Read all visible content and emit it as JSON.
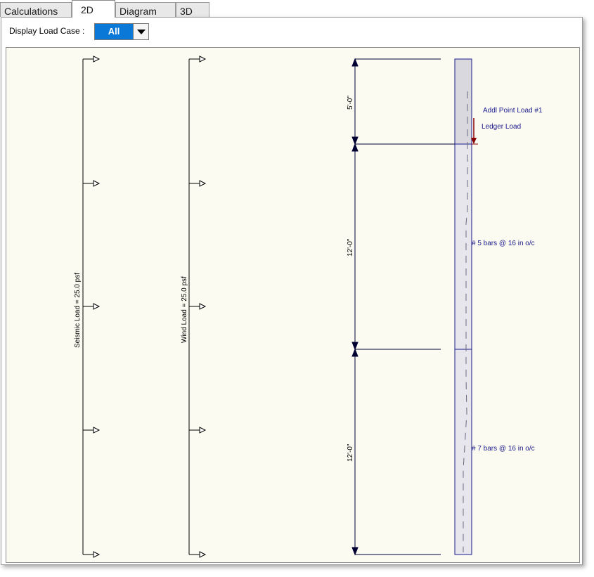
{
  "tabs": [
    {
      "label": "Calculations"
    },
    {
      "label": "2D"
    },
    {
      "label": "Diagram"
    },
    {
      "label": "3D"
    }
  ],
  "toolbar": {
    "display_load_case_label": "Display Load Case :",
    "display_load_case_value": "All"
  },
  "diagram": {
    "seismic_load_label": "Seismic Load = 25.0 psf",
    "wind_load_label": "Wind Load = 25.0 psf",
    "dimensions": [
      "5'-0\"",
      "12'-0\"",
      "12'-0\""
    ],
    "addl_point_load_label": "Addl Point Load #1",
    "ledger_load_label": "Ledger Load",
    "rebar_upper_label": "# 5 bars @ 16 in o/c",
    "rebar_lower_label": "# 7 bars @ 16 in o/c",
    "colors": {
      "dimension": "#000033",
      "wall_fill": "#dcdce4",
      "wall_edge": "#1a1a8c",
      "label_blue": "#1a1a8c",
      "load_arrow": "#8b0000",
      "canvas_bg": "#fbfbf2"
    }
  }
}
